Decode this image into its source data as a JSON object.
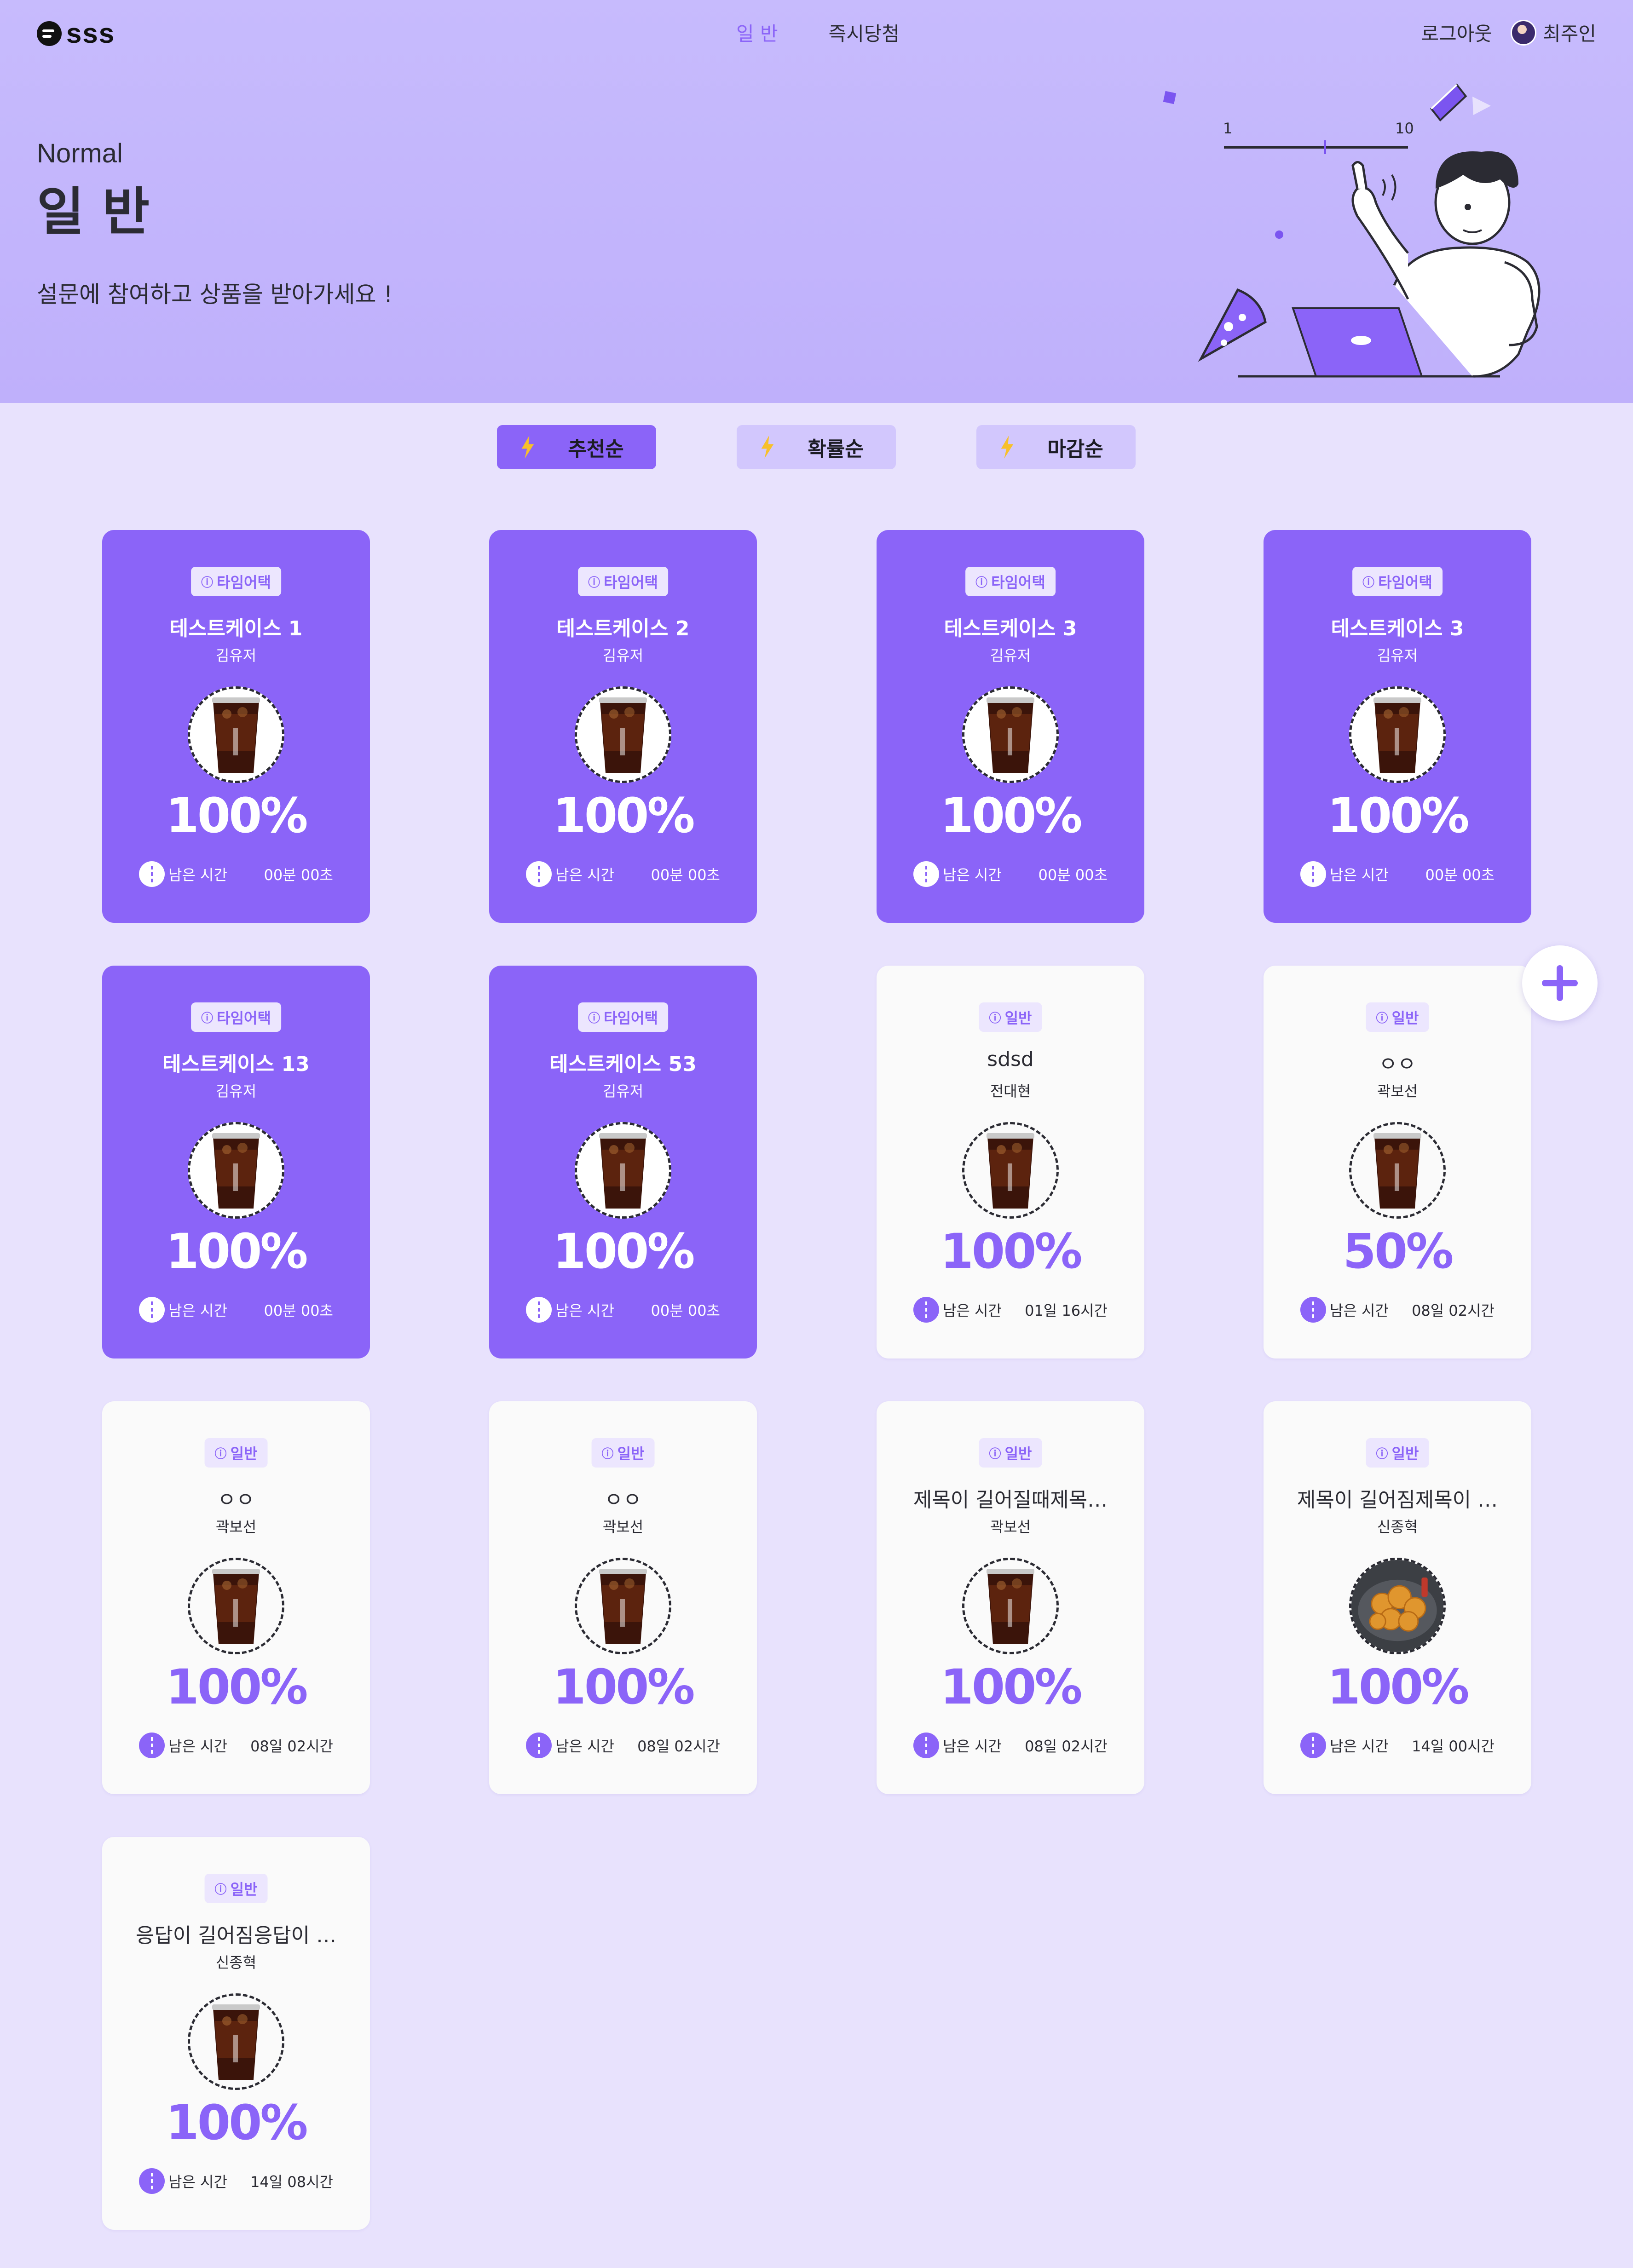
{
  "app": {
    "logo_text": "sss"
  },
  "nav": {
    "items": [
      "일 반",
      "즉시당첨"
    ],
    "active_index": 0
  },
  "account": {
    "logout_label": "로그아웃",
    "user_name": "최주인"
  },
  "hero": {
    "subtitle": "Normal",
    "title": "일 반",
    "description": "설문에 참여하고 상품을 받아가세요 !",
    "illustration_scale": {
      "min_label": "1",
      "max_label": "10"
    }
  },
  "sort_tabs": [
    {
      "label": "추천순",
      "active": true
    },
    {
      "label": "확률순",
      "active": false
    },
    {
      "label": "마감순",
      "active": false
    }
  ],
  "colors": {
    "accent": "#8b64f8",
    "background": "#e8e2fd",
    "hero": "#c7bbfd",
    "bolt": "#f7c02a"
  },
  "remaining_label": "남은 시간",
  "cards": [
    {
      "variant": "purple",
      "badge": "타임어택",
      "title": "테스트케이스 1",
      "author": "김유저",
      "rate": "100%",
      "remaining": "00분 00초",
      "product_icon": "iced-coffee-icon"
    },
    {
      "variant": "purple",
      "badge": "타임어택",
      "title": "테스트케이스 2",
      "author": "김유저",
      "rate": "100%",
      "remaining": "00분 00초",
      "product_icon": "iced-coffee-icon"
    },
    {
      "variant": "purple",
      "badge": "타임어택",
      "title": "테스트케이스 3",
      "author": "김유저",
      "rate": "100%",
      "remaining": "00분 00초",
      "product_icon": "iced-coffee-icon"
    },
    {
      "variant": "purple",
      "badge": "타임어택",
      "title": "테스트케이스 3",
      "author": "김유저",
      "rate": "100%",
      "remaining": "00분 00초",
      "product_icon": "iced-coffee-icon"
    },
    {
      "variant": "purple",
      "badge": "타임어택",
      "title": "테스트케이스 13",
      "author": "김유저",
      "rate": "100%",
      "remaining": "00분 00초",
      "product_icon": "iced-coffee-icon"
    },
    {
      "variant": "purple",
      "badge": "타임어택",
      "title": "테스트케이스 53",
      "author": "김유저",
      "rate": "100%",
      "remaining": "00분 00초",
      "product_icon": "iced-coffee-icon"
    },
    {
      "variant": "white",
      "badge": "일반",
      "title": "sdsd",
      "author": "전대현",
      "rate": "100%",
      "remaining": "01일 16시간",
      "product_icon": "iced-coffee-icon"
    },
    {
      "variant": "white",
      "badge": "일반",
      "title": "ㅇㅇ",
      "author": "곽보선",
      "rate": "50%",
      "remaining": "08일 02시간",
      "product_icon": "iced-coffee-icon"
    },
    {
      "variant": "white",
      "badge": "일반",
      "title": "ㅇㅇ",
      "author": "곽보선",
      "rate": "100%",
      "remaining": "08일 02시간",
      "product_icon": "iced-coffee-icon"
    },
    {
      "variant": "white",
      "badge": "일반",
      "title": "ㅇㅇ",
      "author": "곽보선",
      "rate": "100%",
      "remaining": "08일 02시간",
      "product_icon": "iced-coffee-icon"
    },
    {
      "variant": "white",
      "badge": "일반",
      "title": "제목이 길어질때제목…",
      "author": "곽보선",
      "rate": "100%",
      "remaining": "08일 02시간",
      "product_icon": "iced-coffee-icon"
    },
    {
      "variant": "white",
      "badge": "일반",
      "title": "제목이 길어짐제목이 …",
      "author": "신종혁",
      "rate": "100%",
      "remaining": "14일 00시간",
      "product_icon": "fried-chicken-icon"
    },
    {
      "variant": "white",
      "badge": "일반",
      "title": "응답이 길어짐응답이 …",
      "author": "신종혁",
      "rate": "100%",
      "remaining": "14일 08시간",
      "product_icon": "iced-coffee-icon"
    }
  ],
  "fab": {
    "icon": "plus-icon"
  }
}
